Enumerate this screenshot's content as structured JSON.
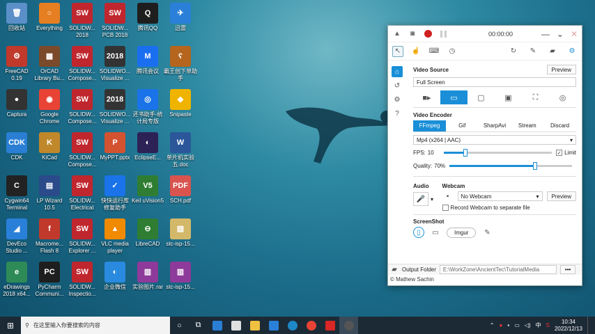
{
  "desktop": {
    "icons": [
      {
        "label": "回收站",
        "icon": "recycle-bin-icon",
        "color": "#5a8fc8",
        "glyph": "🗑"
      },
      {
        "label": "FreeCAD 0.19",
        "icon": "freecad-icon",
        "color": "#c0392b",
        "glyph": "⚙"
      },
      {
        "label": "Captura",
        "icon": "captura-icon",
        "color": "#333333",
        "glyph": "●"
      },
      {
        "label": "CDK",
        "icon": "cdk-icon",
        "color": "#2a7fd4",
        "glyph": "CDK"
      },
      {
        "label": "Cygwin64 Terminal",
        "icon": "cygwin-icon",
        "color": "#222222",
        "glyph": "C"
      },
      {
        "label": "DevEco Studio ...",
        "icon": "deveco-icon",
        "color": "#2a80d8",
        "glyph": "◢"
      },
      {
        "label": "eDrawings 2018 x64...",
        "icon": "edrawings-icon",
        "color": "#2e8b57",
        "glyph": "e"
      },
      {
        "label": "Everything",
        "icon": "everything-icon",
        "color": "#e67e22",
        "glyph": "○"
      },
      {
        "label": "OrCAD Library Bu...",
        "icon": "orcad-icon",
        "color": "#7a4a2a",
        "glyph": "▦"
      },
      {
        "label": "Google Chrome",
        "icon": "chrome-icon",
        "color": "#e84335",
        "glyph": "◉"
      },
      {
        "label": "KiCad",
        "icon": "kicad-icon",
        "color": "#c0882a",
        "glyph": "K"
      },
      {
        "label": "LP Wizard 10.5",
        "icon": "lpwizard-icon",
        "color": "#2a4a8a",
        "glyph": "▤"
      },
      {
        "label": "Macrome... Flash 8",
        "icon": "flash-icon",
        "color": "#c0392b",
        "glyph": "f"
      },
      {
        "label": "PyCharm Communi...",
        "icon": "pycharm-icon",
        "color": "#1e1e1e",
        "glyph": "PC"
      },
      {
        "label": "SOLIDW... 2018",
        "icon": "solidworks-icon",
        "color": "#c0262d",
        "glyph": "SW"
      },
      {
        "label": "SOLIDW... Compose...",
        "icon": "solidworks-composer-icon",
        "color": "#c0262d",
        "glyph": "SW"
      },
      {
        "label": "SOLIDW... Compose...",
        "icon": "solidworks-composer-icon",
        "color": "#c0262d",
        "glyph": "SW"
      },
      {
        "label": "SOLIDW... Compose...",
        "icon": "solidworks-composer-icon",
        "color": "#c0262d",
        "glyph": "SW"
      },
      {
        "label": "SOLIDW... Electrical",
        "icon": "solidworks-electrical-icon",
        "color": "#c0262d",
        "glyph": "SW"
      },
      {
        "label": "SOLIDW... Explorer ...",
        "icon": "solidworks-explorer-icon",
        "color": "#c0262d",
        "glyph": "SW"
      },
      {
        "label": "SOLIDW... Inspectio...",
        "icon": "solidworks-inspection-icon",
        "color": "#c0262d",
        "glyph": "SW"
      },
      {
        "label": "SOLIDW... PCB 2018",
        "icon": "solidworks-pcb-icon",
        "color": "#c0262d",
        "glyph": "SW"
      },
      {
        "label": "SOLIDWO... Visualize ...",
        "icon": "solidworks-visualize-icon",
        "color": "#333333",
        "glyph": "2018"
      },
      {
        "label": "SOLIDWO... Visualize ...",
        "icon": "solidworks-visualize-icon",
        "color": "#333333",
        "glyph": "2018"
      },
      {
        "label": "MyPPT.pptx",
        "icon": "pptx-file-icon",
        "color": "#d35230",
        "glyph": "P"
      },
      {
        "label": "快快运行库 修复助手",
        "icon": "runtime-repair-icon",
        "color": "#1a73e8",
        "glyph": "✓"
      },
      {
        "label": "VLC media player",
        "icon": "vlc-icon",
        "color": "#f08a00",
        "glyph": "▲"
      },
      {
        "label": "企业微信",
        "icon": "wecom-icon",
        "color": "#2a8ae0",
        "glyph": "◐"
      },
      {
        "label": "腾讯QQ",
        "icon": "qq-icon",
        "color": "#1e1e1e",
        "glyph": "Q"
      },
      {
        "label": "腾讯会议",
        "icon": "tencent-meeting-icon",
        "color": "#1a6ff0",
        "glyph": "M"
      },
      {
        "label": "还书助手-统计局专版",
        "icon": "helper-app-icon",
        "color": "#1a73e8",
        "glyph": "◎"
      },
      {
        "label": "EclipseE...",
        "icon": "eclipse-icon",
        "color": "#2c2255",
        "glyph": "◐"
      },
      {
        "label": "Keil uVision5",
        "icon": "keil-icon",
        "color": "#2e7d32",
        "glyph": "V5"
      },
      {
        "label": "LibreCAD",
        "icon": "librecad-icon",
        "color": "#2e7d32",
        "glyph": "⊖"
      },
      {
        "label": "实验图片.rar",
        "icon": "rar-file-icon",
        "color": "#8e3a9a",
        "glyph": "▥"
      },
      {
        "label": "迅雷",
        "icon": "thunder-icon",
        "color": "#2a80d8",
        "glyph": "✈"
      },
      {
        "label": "霸王创下单助手",
        "icon": "bear-app-icon",
        "color": "#b5651d",
        "glyph": "ʕ"
      },
      {
        "label": "Snipaste",
        "icon": "snipaste-icon",
        "color": "#f0b400",
        "glyph": "◆"
      },
      {
        "label": "单片机实验五.doc",
        "icon": "doc-file-icon",
        "color": "#2b579a",
        "glyph": "W"
      },
      {
        "label": "SCH.pdf",
        "icon": "pdf-file-icon",
        "color": "#d9534f",
        "glyph": "PDF"
      },
      {
        "label": "stc-isp-15...",
        "icon": "stc-isp-icon",
        "color": "#d4b86a",
        "glyph": "▧"
      },
      {
        "label": "stc-isp-15...",
        "icon": "rar-file-icon",
        "color": "#8e3a9a",
        "glyph": "▥"
      }
    ]
  },
  "recorder": {
    "timer": "00:00:00",
    "video_source": {
      "title": "Video Source",
      "preview_label": "Preview",
      "value": "Full Screen"
    },
    "video_encoder": {
      "title": "Video Encoder",
      "tabs": [
        "FFmpeg",
        "Gif",
        "SharpAvi",
        "Stream",
        "Discard"
      ],
      "selected_tab": "FFmpeg",
      "codec": "Mp4 (x264 | AAC)",
      "fps_label": "FPS:",
      "fps_value": "10",
      "fps_fraction": 0.2,
      "limit_label": "Limit",
      "limit_checked": true,
      "quality_label": "Quality:",
      "quality_value": "70%",
      "quality_fraction": 0.7
    },
    "audio": {
      "title": "Audio"
    },
    "webcam": {
      "title": "Webcam",
      "selected": "No Webcam",
      "preview_label": "Preview",
      "record_separate_label": "Record Webcam to separate file",
      "record_separate_checked": false
    },
    "screenshot": {
      "title": "ScreenShot",
      "imgur_label": "Imgur"
    },
    "output_folder": {
      "label": "Output Folder",
      "path": "E:\\WorkZone\\AncientTec\\TutorialMedia",
      "more_label": "•••"
    },
    "credit": "© Mathew Sachin"
  },
  "taskbar": {
    "search_placeholder": "在这里输入你要搜索的内容",
    "ime": "中",
    "time": "10:34",
    "date": "2022/12/13"
  }
}
